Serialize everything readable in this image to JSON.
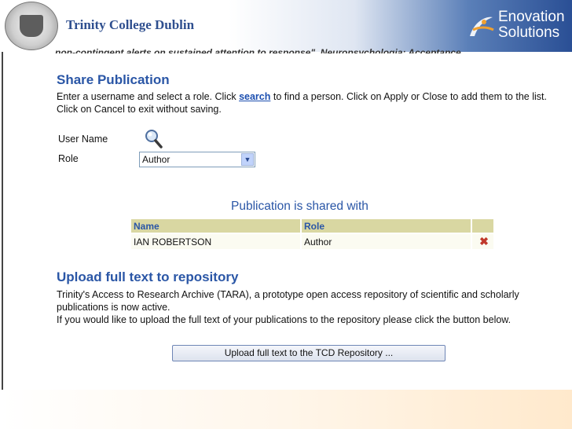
{
  "header": {
    "college_name": "Trinity College Dublin",
    "brand_line1": "Enovation",
    "brand_line2": "Solutions"
  },
  "cut_text": "non-contingent alerts on sustained attention to response\", Neuropsychologia: Acceptance",
  "share": {
    "heading": "Share Publication",
    "instr_before": "Enter a username and select a role. Click ",
    "instr_link": "search",
    "instr_after": " to find a person. Click on Apply or Close to add them to the list. Click on Cancel to exit without saving.",
    "username_label": "User Name",
    "role_label": "Role",
    "role_value": "Author",
    "shared_title": "Publication is shared with",
    "columns": [
      "Name",
      "Role"
    ],
    "rows": [
      {
        "name": "IAN ROBERTSON",
        "role": "Author"
      }
    ]
  },
  "upload": {
    "heading": "Upload full text to repository",
    "line1": "Trinity's Access to Research Archive (TARA), a prototype open access repository of scientific and scholarly publications is now active.",
    "line2": "If you would like to upload the full text of your publications to the repository please click the button below.",
    "button_label": "Upload full text to the TCD Repository ..."
  }
}
